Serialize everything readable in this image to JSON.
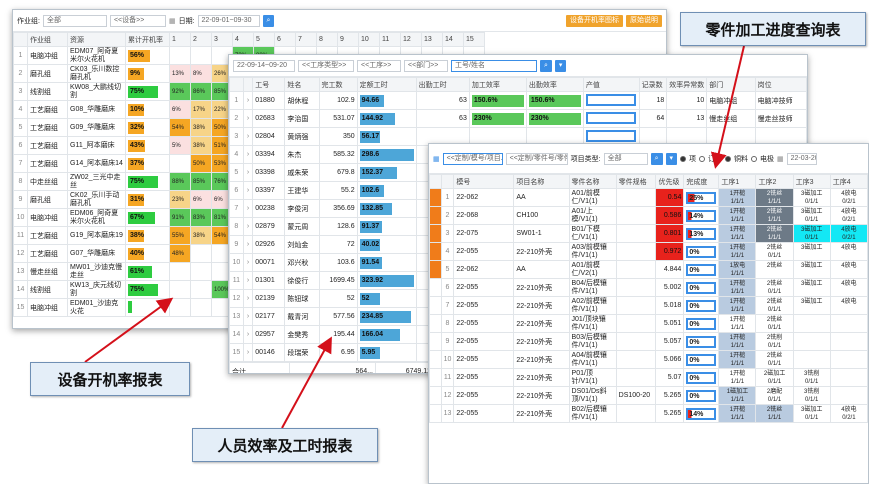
{
  "labels": {
    "report1": "设备开机率报表",
    "report2": "人员效率及工时报表",
    "report3": "零件加工进度查询表"
  },
  "p1": {
    "toolbar": {
      "shop_label": "作业组:",
      "shop_value": "全部",
      "device_placeholder": "<<设备>>",
      "date_label": "日期:",
      "date_value": "22-09-01~09-30",
      "btn_rate": "设备开机率图标",
      "btn_export": "原始说明"
    },
    "headers": [
      "",
      "作业组",
      "资源",
      "累计开机率",
      "1",
      "2",
      "3",
      "4",
      "5",
      "6",
      "7",
      "8",
      "9",
      "10",
      "11",
      "12",
      "13",
      "14",
      "15"
    ],
    "rows": [
      {
        "i": "1",
        "g": "电脑冲组",
        "d": "EDM07_阿奇夏米尔火花机",
        "r": "56%",
        "c": "#f5a623",
        "w": 0.56,
        "cells": [
          "",
          "",
          "",
          "73%",
          "88%",
          "",
          ""
        ]
      },
      {
        "i": "2",
        "g": "磨孔组",
        "d": "CK03_乐川数控磨孔机",
        "r": "9%",
        "c": "#f5a623",
        "w": 0.09,
        "cells": [
          "13%",
          "8%",
          "26%",
          "1%",
          "",
          "",
          ""
        ]
      },
      {
        "i": "3",
        "g": "线割组",
        "d": "KW08_大鹏线切割",
        "r": "75%",
        "c": "#2ecc40",
        "w": 0.75,
        "cells": [
          "92%",
          "86%",
          "85%",
          "72%",
          "",
          "",
          ""
        ]
      },
      {
        "i": "4",
        "g": "工艺磨组",
        "d": "G08_华雕磨床",
        "r": "10%",
        "c": "#f5a623",
        "w": 0.1,
        "cells": [
          "6%",
          "17%",
          "22%",
          "7%",
          "",
          "",
          ""
        ]
      },
      {
        "i": "5",
        "g": "工艺磨组",
        "d": "G09_华雕磨床",
        "r": "32%",
        "c": "#f5a623",
        "w": 0.32,
        "cells": [
          "54%",
          "38%",
          "50%",
          "17%",
          "",
          "",
          ""
        ]
      },
      {
        "i": "6",
        "g": "工艺磨组",
        "d": "G11_阿本磨床",
        "r": "43%",
        "c": "#f5a623",
        "w": 0.43,
        "cells": [
          "5%",
          "38%",
          "51%",
          "38%",
          "",
          "",
          ""
        ]
      },
      {
        "i": "7",
        "g": "工艺磨组",
        "d": "G14_阿本磨床14",
        "r": "37%",
        "c": "#f5a623",
        "w": 0.37,
        "cells": [
          "",
          "50%",
          "53%",
          "",
          "",
          "",
          ""
        ]
      },
      {
        "i": "8",
        "g": "中走丝组",
        "d": "ZW02_三光中走丝",
        "r": "75%",
        "c": "#2ecc40",
        "w": 0.75,
        "cells": [
          "88%",
          "85%",
          "76%",
          "",
          "",
          "",
          ""
        ]
      },
      {
        "i": "9",
        "g": "磨孔组",
        "d": "CK02_乐川手动磨孔机",
        "r": "31%",
        "c": "#f5a623",
        "w": 0.31,
        "cells": [
          "23%",
          "6%",
          "6%",
          "6%",
          "",
          "",
          ""
        ]
      },
      {
        "i": "10",
        "g": "电脑冲组",
        "d": "EDM06_阿奇夏米尔火花机",
        "r": "67%",
        "c": "#2ecc40",
        "w": 0.67,
        "cells": [
          "91%",
          "83%",
          "81%",
          "",
          "",
          "",
          ""
        ]
      },
      {
        "i": "11",
        "g": "工艺磨组",
        "d": "G19_阿本磨床19",
        "r": "38%",
        "c": "#f5a623",
        "w": 0.38,
        "cells": [
          "55%",
          "38%",
          "54%",
          "",
          "",
          "",
          ""
        ]
      },
      {
        "i": "12",
        "g": "工艺磨组",
        "d": "G07_华雕磨床",
        "r": "40%",
        "c": "#f5a623",
        "w": 0.4,
        "cells": [
          "48%",
          "",
          "",
          "",
          "",
          "",
          ""
        ]
      },
      {
        "i": "13",
        "g": "慢走丝组",
        "d": "MW01_沙迪克慢走丝",
        "r": "61%",
        "c": "#2ecc40",
        "w": 0.61,
        "cells": [
          "",
          "",
          "",
          "",
          "",
          "",
          ""
        ]
      },
      {
        "i": "14",
        "g": "线割组",
        "d": "KW13_庆元线切割",
        "r": "75%",
        "c": "#2ecc40",
        "w": 0.75,
        "cells": [
          "",
          "",
          "100%",
          "100%",
          "",
          "",
          ""
        ]
      },
      {
        "i": "15",
        "g": "电脑冲组",
        "d": "EDM01_沙迪克火花",
        "r": "",
        "c": "#2ecc40",
        "w": 0,
        "cells": [
          "",
          "",
          "",
          "",
          "",
          "",
          ""
        ]
      }
    ]
  },
  "p2": {
    "toolbar": {
      "date": "22-09-14~09-20",
      "worktype": "<<工序类型>>",
      "process": "<<工序>>",
      "dept": "<<部门>>",
      "search_placeholder": "工号/姓名"
    },
    "headers": [
      "",
      "",
      "工号",
      "姓名",
      "完工数",
      "定额工时",
      "出勤工时",
      "加工效率",
      "出勤效率",
      "产值",
      "记录数",
      "效率异常数",
      "部门",
      "岗位"
    ],
    "rows": [
      {
        "i": "1",
        "no": "01880",
        "n": "胡休程",
        "q": "102.9",
        "h": "94.66",
        "hw": 0.45,
        "a": "63",
        "e": "150.6%",
        "ew": 1,
        "ae": "150.6%",
        "aw": 1,
        "rec": "18",
        "ab": "10",
        "dp": "电脑冲组",
        "ps": "电脑冲技师"
      },
      {
        "i": "2",
        "no": "02683",
        "n": "李治国",
        "q": "531.07",
        "h": "144.92",
        "hw": 0.65,
        "a": "63",
        "e": "230%",
        "ew": 1,
        "ae": "230%",
        "aw": 1,
        "rec": "64",
        "ab": "13",
        "dp": "慢走丝组",
        "ps": "慢走丝技师"
      },
      {
        "i": "3",
        "no": "02804",
        "n": "黄炳强",
        "q": "350",
        "h": "56.17",
        "hw": 0.25,
        "a": "",
        "e": "",
        "ew": 0,
        "ae": "",
        "aw": 0,
        "rec": "",
        "ab": "",
        "dp": "",
        "ps": ""
      },
      {
        "i": "4",
        "no": "03394",
        "n": "朱杰",
        "q": "585.32",
        "h": "298.6",
        "hw": 1,
        "a": "",
        "e": "",
        "ew": 0,
        "ae": "",
        "aw": 0,
        "rec": "",
        "ab": "",
        "dp": "",
        "ps": ""
      },
      {
        "i": "5",
        "no": "03398",
        "n": "戚朱荣",
        "q": "679.8",
        "h": "152.37",
        "hw": 0.7,
        "a": "",
        "e": "",
        "ew": 0,
        "ae": "",
        "aw": 0,
        "rec": "",
        "ab": "",
        "dp": "",
        "ps": ""
      },
      {
        "i": "6",
        "no": "03397",
        "n": "王建华",
        "q": "55.2",
        "h": "102.6",
        "hw": 0.45,
        "a": "",
        "e": "",
        "ew": 0,
        "ae": "",
        "aw": 0,
        "rec": "",
        "ab": "",
        "dp": "",
        "ps": ""
      },
      {
        "i": "7",
        "no": "00238",
        "n": "李俊河",
        "q": "356.69",
        "h": "132.85",
        "hw": 0.6,
        "a": "",
        "e": "",
        "ew": 0,
        "ae": "",
        "aw": 0,
        "rec": "",
        "ab": "",
        "dp": "",
        "ps": ""
      },
      {
        "i": "8",
        "no": "02879",
        "n": "蒙元周",
        "q": "128.6",
        "h": "91.37",
        "hw": 0.42,
        "a": "",
        "e": "",
        "ew": 0,
        "ae": "",
        "aw": 0,
        "rec": "",
        "ab": "",
        "dp": "",
        "ps": ""
      },
      {
        "i": "9",
        "no": "02926",
        "n": "刘灿金",
        "q": "72",
        "h": "40.02",
        "hw": 0.18,
        "a": "",
        "e": "",
        "ew": 0,
        "ae": "",
        "aw": 0,
        "rec": "",
        "ab": "",
        "dp": "",
        "ps": ""
      },
      {
        "i": "10",
        "no": "00071",
        "n": "邓兴秋",
        "q": "103.6",
        "h": "91.54",
        "hw": 0.42,
        "a": "",
        "e": "",
        "ew": 0,
        "ae": "",
        "aw": 0,
        "rec": "",
        "ab": "",
        "dp": "",
        "ps": ""
      },
      {
        "i": "11",
        "no": "01301",
        "n": "徐俊行",
        "q": "1699.45",
        "h": "323.92",
        "hw": 1,
        "a": "",
        "e": "",
        "ew": 0,
        "ae": "",
        "aw": 0,
        "rec": "",
        "ab": "",
        "dp": "",
        "ps": ""
      },
      {
        "i": "12",
        "no": "02139",
        "n": "陈钮球",
        "q": "52",
        "h": "52",
        "hw": 0.22,
        "a": "",
        "e": "",
        "ew": 0,
        "ae": "",
        "aw": 0,
        "rec": "",
        "ab": "",
        "dp": "",
        "ps": ""
      },
      {
        "i": "13",
        "no": "02177",
        "n": "戴青河",
        "q": "577.56",
        "h": "234.85",
        "hw": 0.95,
        "a": "",
        "e": "",
        "ew": 0,
        "ae": "",
        "aw": 0,
        "rec": "",
        "ab": "",
        "dp": "",
        "ps": ""
      },
      {
        "i": "14",
        "no": "02957",
        "n": "金樊秀",
        "q": "195.44",
        "h": "166.04",
        "hw": 0.75,
        "a": "",
        "e": "",
        "ew": 0,
        "ae": "",
        "aw": 0,
        "rec": "",
        "ab": "",
        "dp": "",
        "ps": ""
      },
      {
        "i": "15",
        "no": "00146",
        "n": "段瑞荣",
        "q": "6.95",
        "h": "5.95",
        "hw": 0.05,
        "a": "",
        "e": "",
        "ew": 0,
        "ae": "",
        "aw": 0,
        "rec": "",
        "ab": "",
        "dp": "",
        "ps": ""
      }
    ],
    "footer": {
      "label": "合计",
      "qty": "564...",
      "hours": "6749.12",
      "att": "1523"
    }
  },
  "p3": {
    "toolbar": {
      "search_placeholder": "<<定制/模号/项目...",
      "search2_placeholder": "<<定制/零件号/零件...",
      "type_label": "项目类型:",
      "type_value": "全部",
      "r1": "项",
      "r2": "订单",
      "r3": "铜料",
      "r4": "电极",
      "date": "22-03-20~"
    },
    "headers": [
      "",
      "",
      "模号",
      "项目名称",
      "零件名称",
      "零件规格",
      "优先级",
      "完成度",
      "工序1",
      "工序2",
      "工序3",
      "工序4"
    ],
    "rows": [
      {
        "i": "1",
        "ic": "#f07c1a",
        "m": "22-062",
        "p": "AA",
        "pt": "A01/前模仁/V1(1)",
        "sp": "",
        "pr": "0.54",
        "pc": "#e8221c",
        "done": "25%",
        "dw": 0.25,
        "s": [
          [
            "1开槌",
            "1/1/1",
            "#b9cbe0"
          ],
          [
            "2铣丝",
            "1/1/1",
            "#6d7a87"
          ],
          [
            "3磁加工",
            "0/1/1",
            "#ffffff"
          ],
          [
            "4放电",
            "0/2/1",
            "#ffffff"
          ]
        ]
      },
      {
        "i": "2",
        "ic": "#f07c1a",
        "m": "22-068",
        "p": "CH100",
        "pt": "A01/上模/V1(1)",
        "sp": "",
        "pr": "0.586",
        "pc": "#e8221c",
        "done": "14%",
        "dw": 0.14,
        "s": [
          [
            "1开槌",
            "1/1/1",
            "#b9cbe0"
          ],
          [
            "2铣丝",
            "1/1/1",
            "#6d7a87"
          ],
          [
            "3磁加工",
            "0/1/1",
            "#ffffff"
          ],
          [
            "4放电",
            "0/2/1",
            "#ffffff"
          ]
        ]
      },
      {
        "i": "3",
        "ic": "#f07c1a",
        "m": "22-075",
        "p": "SW01-1",
        "pt": "B01/下模仁/V1(1)",
        "sp": "",
        "pr": "0.801",
        "pc": "#e8221c",
        "done": "13%",
        "dw": 0.13,
        "s": [
          [
            "1开槌",
            "1/1/1",
            "#b9cbe0"
          ],
          [
            "2铣丝",
            "1/1/1",
            "#6d7a87"
          ],
          [
            "3磁加工",
            "0/1/1",
            "#13e8f5"
          ],
          [
            "4放电",
            "0/2/1",
            "#13e8f5"
          ]
        ]
      },
      {
        "i": "4",
        "ic": "#f07c1a",
        "m": "22-055",
        "p": "22-210外壳",
        "pt": "A03/前模镶件/V1(1)",
        "sp": "",
        "pr": "0.972",
        "pc": "#e8221c",
        "done": "0%",
        "dw": 0,
        "s": [
          [
            "1开槌",
            "1/1/1",
            "#b9cbe0"
          ],
          [
            "2铣丝",
            "0/1/1",
            "#ffffff"
          ],
          [
            "3磁加工",
            "",
            "#ffffff"
          ],
          [
            "4放电",
            "",
            "#ffffff"
          ]
        ]
      },
      {
        "i": "5",
        "ic": "#f07c1a",
        "m": "22-062",
        "p": "AA",
        "pt": "A01/前模仁/V2(1)",
        "sp": "",
        "pr": "4.844",
        "pc": "",
        "done": "0%",
        "dw": 0,
        "s": [
          [
            "1放电",
            "1/1/1",
            "#b9cbe0"
          ],
          [
            "2铣丝",
            "",
            "#ffffff"
          ],
          [
            "3磁加工",
            "",
            "#ffffff"
          ],
          [
            "4放电",
            "",
            "#ffffff"
          ]
        ]
      },
      {
        "i": "6",
        "ic": "",
        "m": "22-055",
        "p": "22-210外壳",
        "pt": "B04/后模镶件/V1(1)",
        "sp": "",
        "pr": "5.002",
        "pc": "",
        "done": "0%",
        "dw": 0,
        "s": [
          [
            "1开槌",
            "1/1/1",
            "#b9cbe0"
          ],
          [
            "2铣丝",
            "0/1/1",
            "#ffffff"
          ],
          [
            "3磁加工",
            "",
            "#ffffff"
          ],
          [
            "4放电",
            "",
            "#ffffff"
          ]
        ]
      },
      {
        "i": "7",
        "ic": "",
        "m": "22-055",
        "p": "22-210外壳",
        "pt": "A02/前模镶件/V1(1)",
        "sp": "",
        "pr": "5.018",
        "pc": "",
        "done": "0%",
        "dw": 0,
        "s": [
          [
            "1开槌",
            "1/1/1",
            "#b9cbe0"
          ],
          [
            "2铣丝",
            "0/1/1",
            "#ffffff"
          ],
          [
            "3磁加工",
            "",
            "#ffffff"
          ],
          [
            "4放电",
            "",
            "#ffffff"
          ]
        ]
      },
      {
        "i": "8",
        "ic": "",
        "m": "22-055",
        "p": "22-210外壳",
        "pt": "J01/顶块镶件/V1(1)",
        "sp": "",
        "pr": "5.051",
        "pc": "",
        "done": "0%",
        "dw": 0,
        "s": [
          [
            "1开槌",
            "1/1/1",
            "#ffffff"
          ],
          [
            "2铣丝",
            "0/1/1",
            "#ffffff"
          ],
          [
            "",
            "",
            "#ffffff"
          ],
          [
            "",
            "",
            "#ffffff"
          ]
        ]
      },
      {
        "i": "9",
        "ic": "",
        "m": "22-055",
        "p": "22-210外壳",
        "pt": "B03/后模镶件/V1(1)",
        "sp": "",
        "pr": "5.057",
        "pc": "",
        "done": "0%",
        "dw": 0,
        "s": [
          [
            "1开槌",
            "1/1/1",
            "#b9cbe0"
          ],
          [
            "2铣削",
            "0/1/1",
            "#ffffff"
          ],
          [
            "",
            "",
            "#ffffff"
          ],
          [
            "",
            "",
            "#ffffff"
          ]
        ]
      },
      {
        "i": "10",
        "ic": "",
        "m": "22-055",
        "p": "22-210外壳",
        "pt": "A04/前模镶件/V1(1)",
        "sp": "",
        "pr": "5.066",
        "pc": "",
        "done": "0%",
        "dw": 0,
        "s": [
          [
            "1开槌",
            "1/1/1",
            "#b9cbe0"
          ],
          [
            "2铣丝",
            "0/1/1",
            "#ffffff"
          ],
          [
            "",
            "",
            "#ffffff"
          ],
          [
            "",
            "",
            "#ffffff"
          ]
        ]
      },
      {
        "i": "11",
        "ic": "",
        "m": "22-055",
        "p": "22-210外壳",
        "pt": "P01/顶针/V1(1)",
        "sp": "",
        "pr": "5.07",
        "pc": "",
        "done": "0%",
        "dw": 0,
        "s": [
          [
            "1开槌",
            "1/1/1",
            "#ffffff"
          ],
          [
            "2磁加工",
            "0/1/1",
            "#ffffff"
          ],
          [
            "3铣削",
            "0/1/1",
            "#ffffff"
          ],
          [
            "",
            "",
            "#ffffff"
          ]
        ]
      },
      {
        "i": "12",
        "ic": "",
        "m": "22-055",
        "p": "22-210外壳",
        "pt": "DS01/Ds斜顶/V1(1)",
        "sp": "DS100-20",
        "pr": "5.265",
        "pc": "",
        "done": "0%",
        "dw": 0,
        "s": [
          [
            "1磁加工",
            "1/1/1",
            "#b9cbe0"
          ],
          [
            "2磨配",
            "0/1/1",
            "#ffffff"
          ],
          [
            "3铣削",
            "0/1/1",
            "#ffffff"
          ],
          [
            "",
            "",
            "#ffffff"
          ]
        ]
      },
      {
        "i": "13",
        "ic": "",
        "m": "22-055",
        "p": "22-210外壳",
        "pt": "B02/后模镶件/V1(1)",
        "sp": "",
        "pr": "5.265",
        "pc": "",
        "done": "14%",
        "dw": 0.14,
        "s": [
          [
            "1开槌",
            "1/1/1",
            "#b9cbe0"
          ],
          [
            "2铣丝",
            "1/1/1",
            "#b9cbe0"
          ],
          [
            "3磁加工",
            "0/1/1",
            "#ffffff"
          ],
          [
            "4放电",
            "0/2/1",
            "#ffffff"
          ]
        ]
      }
    ]
  }
}
